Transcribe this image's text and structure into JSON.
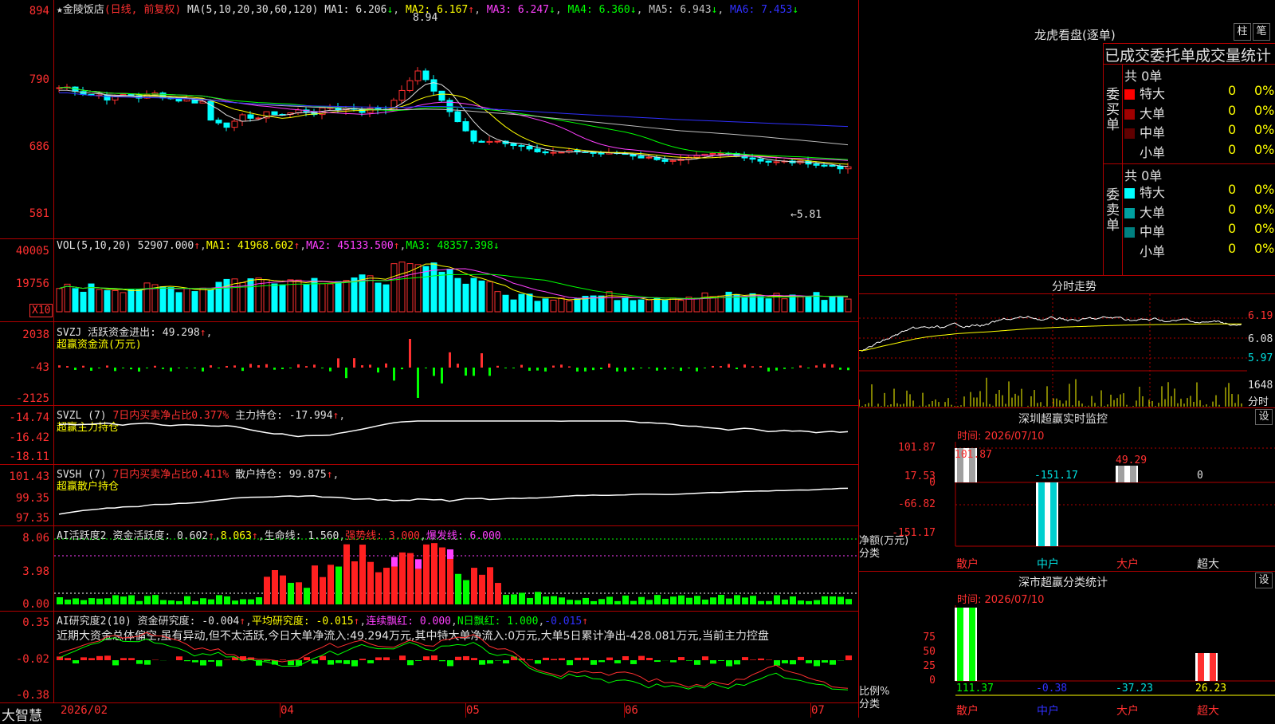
{
  "main": {
    "star": "★",
    "name": "金陵饭店",
    "period": "(日线, 前复权)",
    "ma_params": "MA(5,10,20,30,60,120)",
    "ma": [
      {
        "label": "MA1: 6.206",
        "arrow": "↓",
        "color": "#e0e0e0"
      },
      {
        "label": "MA2: 6.167",
        "arrow": "↑",
        "color": "#ffff00"
      },
      {
        "label": "MA3: 6.247",
        "arrow": "↓",
        "color": "#ff40ff"
      },
      {
        "label": "MA4: 6.360",
        "arrow": "↓",
        "color": "#00ff00"
      },
      {
        "label": "MA5: 6.943",
        "arrow": "↓",
        "color": "#c0c0c0"
      },
      {
        "label": "MA6: 7.453",
        "arrow": "↓",
        "color": "#3030ff"
      }
    ],
    "high": "8.94",
    "low": "5.81",
    "low_arrow": "←",
    "yticks": [
      "894",
      "790",
      "686",
      "581"
    ]
  },
  "vol": {
    "title": "VOL(5,10,20)",
    "val": "52907.000",
    "ma1": "MA1: 41968.602",
    "ma2": "MA2: 45133.500",
    "ma3": "MA3: 48357.398",
    "unit": "X10",
    "yticks": [
      "40005",
      "19756"
    ]
  },
  "svzj": {
    "title": "SVZJ",
    "t1": "活跃资金进出: 49.298",
    "t2": "超赢资金流(万元)",
    "yticks": [
      "2038",
      "-43",
      "-2125"
    ]
  },
  "svzl": {
    "title": "SVZL (7)",
    "t1": "7日内买卖净占比0.377%",
    "t2": "主力持仓: -17.994",
    "t3": "超赢主力持仓",
    "yticks": [
      "-14.74",
      "-16.42",
      "-18.11"
    ]
  },
  "svsh": {
    "title": "SVSH (7)",
    "t1": "7日内买卖净占比0.411%",
    "t2": "散户持仓: 99.875",
    "t3": "超赢散户持仓",
    "yticks": [
      "101.43",
      "99.35",
      "97.35"
    ]
  },
  "ai1": {
    "title": "AI活跃度2",
    "t1": "资金活跃度: 0.602",
    "t2": "8.063",
    "t3": "生命线: 1.560",
    "t4": "强势线: 3.000",
    "t5": "爆发线: 6.000",
    "yticks": [
      "8.06",
      "3.98",
      "0.00"
    ]
  },
  "ai2": {
    "title": "AI研究度2(10)",
    "t1": "资金研究度: -0.004",
    "t2": "平均研究度: -0.015",
    "t3": "连续飘红: 0.000",
    "t4": "N日飘红: 1.000",
    "t5": "-0.015",
    "summary": "近期大资金总体偏空,虽有异动,但不太活跃,今日大单净流入:49.294万元,其中特大单净流入:0万元,大单5日累计净出-428.081万元,当前主力控盘",
    "yticks": [
      "0.35",
      "-0.02",
      "-0.38"
    ]
  },
  "xaxis": {
    "brand": "大智慧",
    "labels": [
      "2026/02",
      "04",
      "05",
      "06",
      "07"
    ]
  },
  "right": {
    "dragon": {
      "title": "龙虎看盘(逐单)",
      "btn1": "柱",
      "btn2": "笔",
      "header": "已成交委托单成交量统计",
      "buy": {
        "side": "委买单",
        "total": "共 0单",
        "rows": [
          {
            "name": "特大",
            "qty": "0",
            "pct": "0%",
            "color": "#ff0000"
          },
          {
            "name": "大单",
            "qty": "0",
            "pct": "0%",
            "color": "#a00000"
          },
          {
            "name": "中单",
            "qty": "0",
            "pct": "0%",
            "color": "#600000"
          },
          {
            "name": "小单",
            "qty": "0",
            "pct": "0%",
            "color": "#000000"
          }
        ]
      },
      "sell": {
        "side": "委卖单",
        "total": "共 0单",
        "rows": [
          {
            "name": "特大",
            "qty": "0",
            "pct": "0%",
            "color": "#00ffff"
          },
          {
            "name": "大单",
            "qty": "0",
            "pct": "0%",
            "color": "#00a0a0"
          },
          {
            "name": "中单",
            "qty": "0",
            "pct": "0%",
            "color": "#008080"
          },
          {
            "name": "小单",
            "qty": "0",
            "pct": "0%",
            "color": "#000000"
          }
        ]
      }
    },
    "intraday": {
      "title": "分时走势",
      "prices": [
        "6.19",
        "6.08",
        "5.97"
      ],
      "vol": "1648",
      "vol_unit": "分时"
    },
    "monitor": {
      "title": "深圳超赢实时监控",
      "btn": "设",
      "time": "时间: 2026/07/10",
      "yticks": [
        "101.87",
        "17.53",
        "0",
        "-66.82",
        "-151.17"
      ],
      "ylabel": "净额(万元)",
      "xlabel": "分类",
      "values": {
        "retail": "101.87",
        "mid": "-151.17",
        "big": "49.29",
        "super": "0"
      },
      "cats": [
        "散户",
        "中户",
        "大户",
        "超大"
      ]
    },
    "classstat": {
      "title": "深市超赢分类统计",
      "btn": "设",
      "time": "时间: 2026/07/10",
      "yticks": [
        "75",
        "50",
        "25",
        "0"
      ],
      "ylabel": "比例%",
      "xlabel": "分类",
      "vals": [
        "111.37",
        "-0.38",
        "-37.23",
        "26.23"
      ],
      "cats": [
        "散户",
        "中户",
        "大户",
        "超大"
      ]
    }
  }
}
